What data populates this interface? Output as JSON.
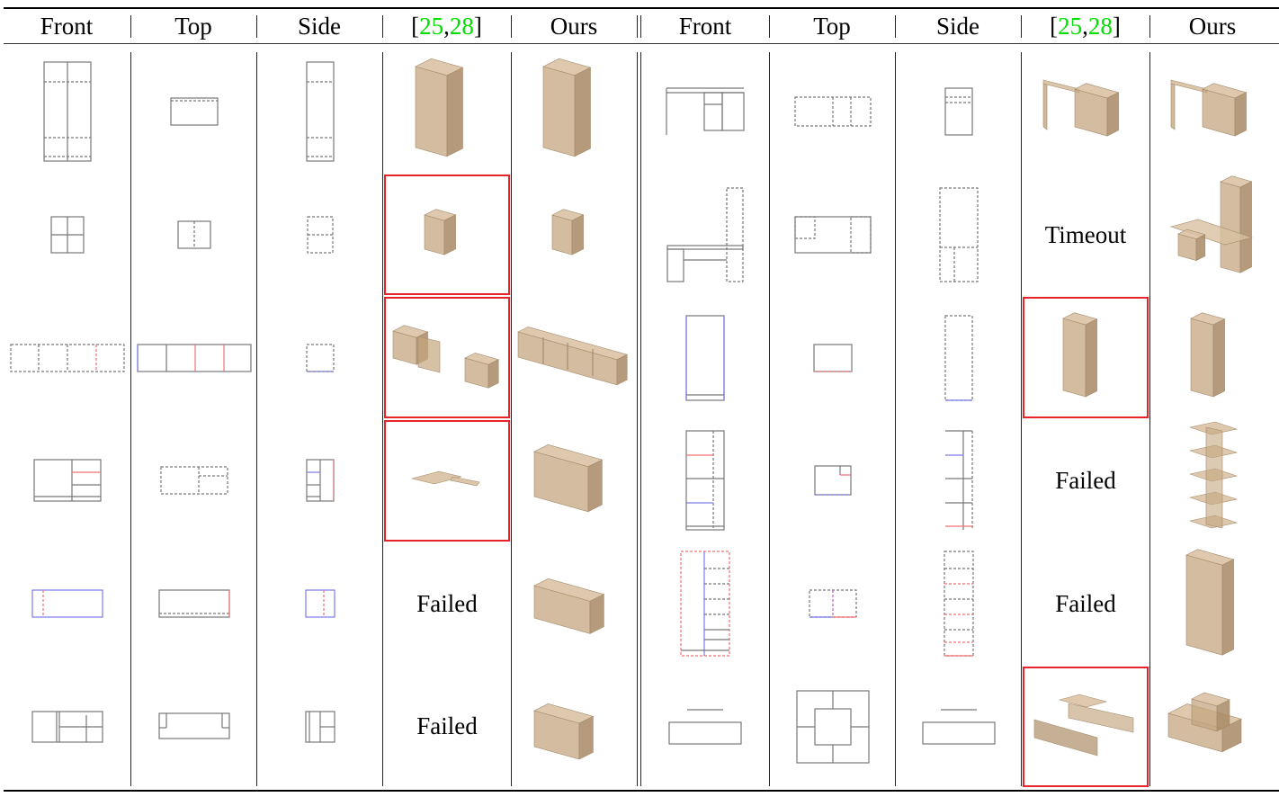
{
  "table": {
    "header_left": [
      "Front",
      "Top",
      "Side",
      "CITE",
      "Ours"
    ],
    "header_right": [
      "Front",
      "Top",
      "Side",
      "CITE",
      "Ours"
    ],
    "citation": {
      "open": "[",
      "ref1": "25",
      "sep": ", ",
      "ref2": "28",
      "close": "]"
    },
    "colors": {
      "citation": "#00e000",
      "failure_box": "#e8232a",
      "furniture": "#c8aa88",
      "line": "#777777",
      "line_red": "#f07070",
      "line_blue": "#7a7ae8"
    },
    "rows": [
      {
        "left": {
          "object": "tall wardrobe with two doors and shelves",
          "baseline": {
            "type": "render",
            "failure_box": false
          },
          "ours": "render"
        },
        "right": {
          "object": "desk with side shelving unit",
          "baseline": {
            "type": "render",
            "failure_box": false
          },
          "ours": "render"
        }
      },
      {
        "left": {
          "object": "small 2x2 cube shelf",
          "baseline": {
            "type": "render",
            "failure_box": true
          },
          "ours": "render"
        },
        "right": {
          "object": "desk with tall cabinet",
          "baseline": {
            "type": "text",
            "text": "Timeout"
          },
          "ours": "render"
        }
      },
      {
        "left": {
          "object": "four-compartment long shelf",
          "baseline": {
            "type": "render",
            "failure_box": true
          },
          "ours": "render"
        },
        "right": {
          "object": "tall single-door cabinet",
          "baseline": {
            "type": "render",
            "failure_box": true
          },
          "ours": "render"
        }
      },
      {
        "left": {
          "object": "cabinet with side shelves",
          "baseline": {
            "type": "render",
            "failure_box": true
          },
          "ours": "render"
        },
        "right": {
          "object": "open bookshelf",
          "baseline": {
            "type": "text",
            "text": "Failed"
          },
          "ours": "render"
        }
      },
      {
        "left": {
          "object": "low sideboard",
          "baseline": {
            "type": "text",
            "text": "Failed"
          },
          "ours": "render"
        },
        "right": {
          "object": "wardrobe with drawers",
          "baseline": {
            "type": "text",
            "text": "Failed"
          },
          "ours": "render"
        }
      },
      {
        "left": {
          "object": "TV stand with compartments",
          "baseline": {
            "type": "text",
            "text": "Failed"
          },
          "ours": "render"
        },
        "right": {
          "object": "square modular table",
          "baseline": {
            "type": "render",
            "failure_box": true
          },
          "ours": "render"
        }
      }
    ]
  }
}
